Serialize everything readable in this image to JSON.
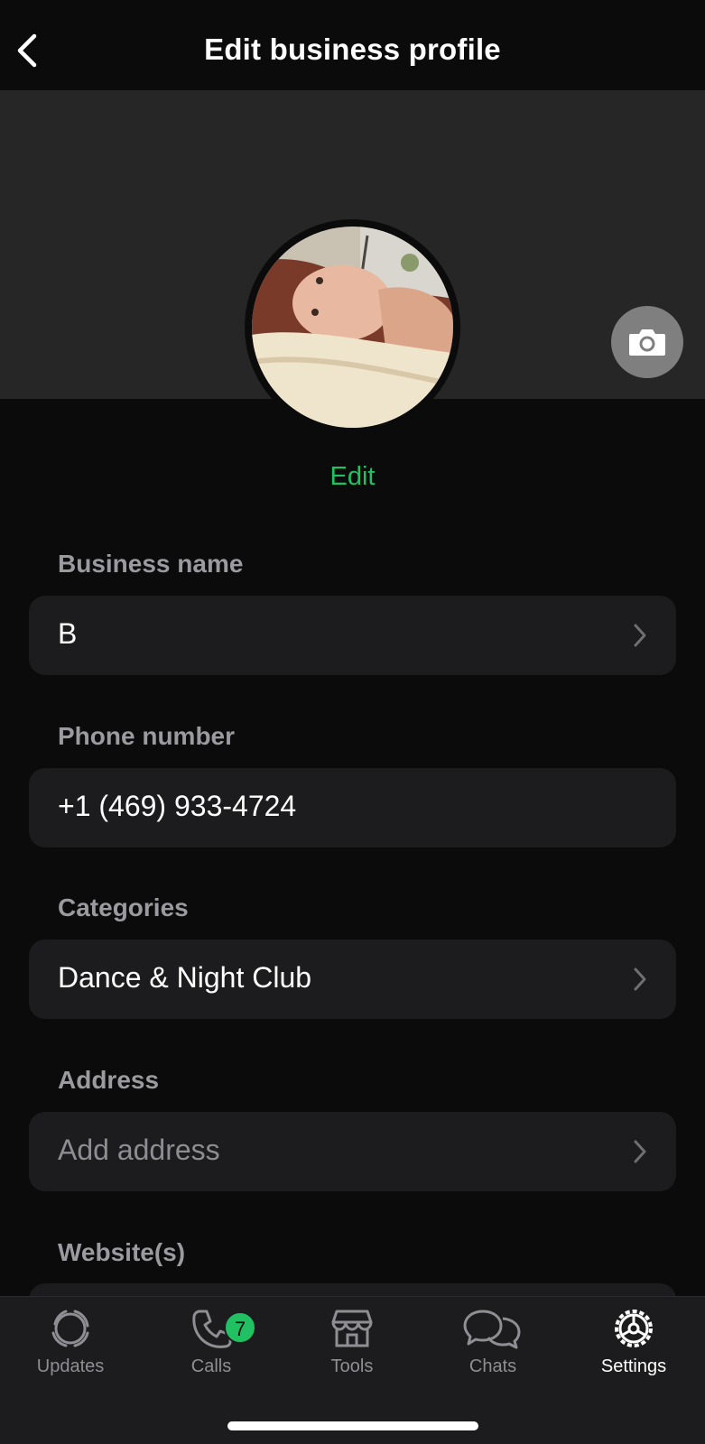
{
  "header": {
    "title": "Edit business profile"
  },
  "profile": {
    "edit_label": "Edit"
  },
  "fields": [
    {
      "label": "Business name",
      "value": "B",
      "placeholder": "",
      "has_chevron": true
    },
    {
      "label": "Phone number",
      "value": "+1 (469) 933-4724",
      "placeholder": "",
      "has_chevron": false
    },
    {
      "label": "Categories",
      "value": "Dance & Night Club",
      "placeholder": "",
      "has_chevron": true
    },
    {
      "label": "Address",
      "value": "",
      "placeholder": "Add address",
      "has_chevron": true
    },
    {
      "label": "Website(s)",
      "value": "",
      "placeholder": "",
      "has_chevron": false
    }
  ],
  "tabbar": {
    "tabs": [
      {
        "label": "Updates",
        "icon": "updates-icon"
      },
      {
        "label": "Calls",
        "icon": "phone-icon",
        "badge": "7"
      },
      {
        "label": "Tools",
        "icon": "storefront-icon"
      },
      {
        "label": "Chats",
        "icon": "chats-icon"
      },
      {
        "label": "Settings",
        "icon": "gear-icon",
        "active": true
      }
    ]
  },
  "colors": {
    "accent": "#21c063",
    "background": "#0b0b0c",
    "cover": "#262627",
    "field": "#1c1c1e"
  }
}
